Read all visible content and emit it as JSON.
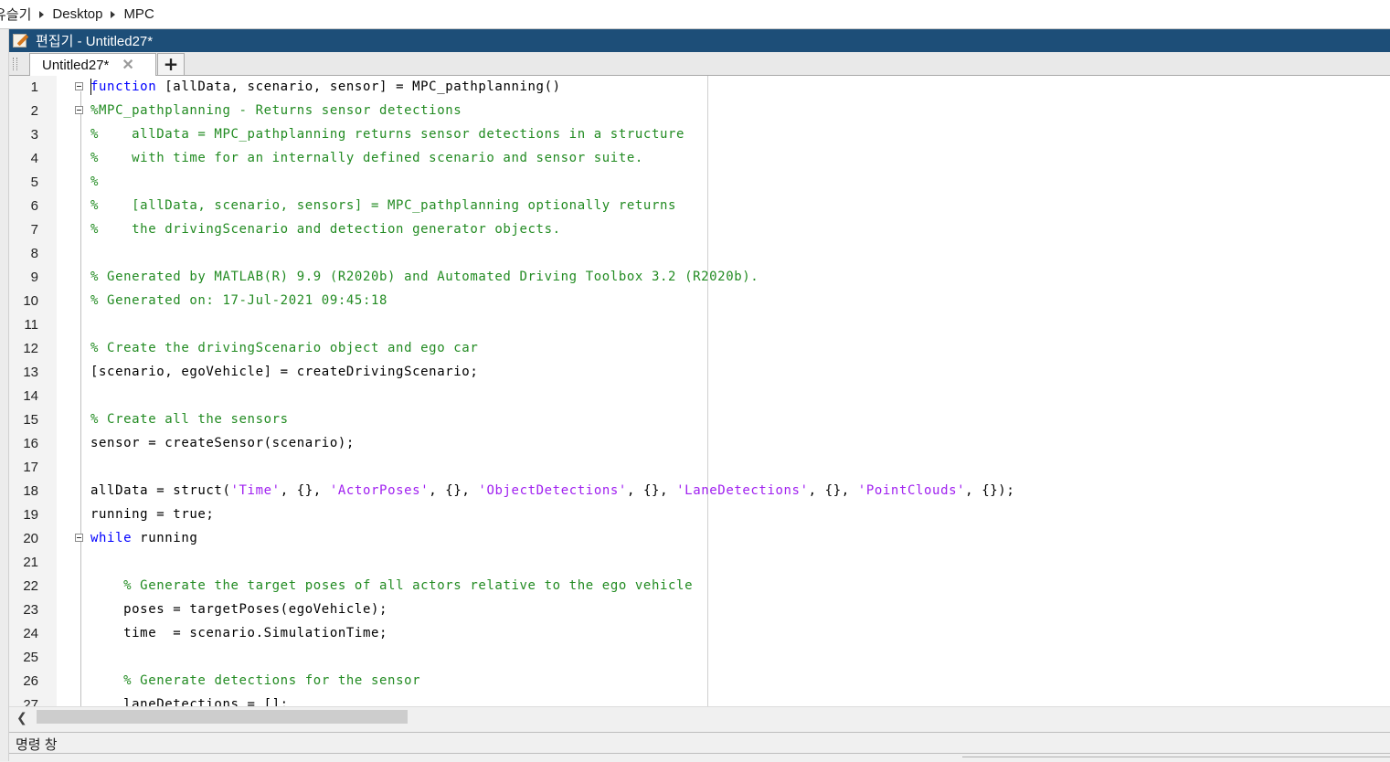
{
  "breadcrumb": {
    "items": [
      "유슬기",
      "Desktop",
      "MPC"
    ]
  },
  "editor_window": {
    "title": "편집기 - Untitled27*"
  },
  "tabs": [
    {
      "label": "Untitled27*",
      "close_icon": "close-icon"
    }
  ],
  "add_tab_label": "+",
  "code_lines": [
    {
      "n": "1",
      "fold": true,
      "parts": [
        [
          "kw",
          "function"
        ],
        [
          "p",
          " [allData, scenario, sensor] = MPC_pathplanning()"
        ]
      ]
    },
    {
      "n": "2",
      "fold": true,
      "parts": [
        [
          "cm",
          "%MPC_pathplanning - Returns sensor detections"
        ]
      ]
    },
    {
      "n": "3",
      "fold": false,
      "parts": [
        [
          "cm",
          "%    allData = MPC_pathplanning returns sensor detections in a structure"
        ]
      ]
    },
    {
      "n": "4",
      "fold": false,
      "parts": [
        [
          "cm",
          "%    with time for an internally defined scenario and sensor suite."
        ]
      ]
    },
    {
      "n": "5",
      "fold": false,
      "parts": [
        [
          "cm",
          "%"
        ]
      ]
    },
    {
      "n": "6",
      "fold": false,
      "parts": [
        [
          "cm",
          "%    [allData, scenario, sensors] = MPC_pathplanning optionally returns"
        ]
      ]
    },
    {
      "n": "7",
      "fold": false,
      "parts": [
        [
          "cm",
          "%    the drivingScenario and detection generator objects."
        ]
      ]
    },
    {
      "n": "8",
      "fold": false,
      "parts": []
    },
    {
      "n": "9",
      "fold": false,
      "parts": [
        [
          "cm",
          "% Generated by MATLAB(R) 9.9 (R2020b) and Automated Driving Toolbox 3.2 (R2020b)."
        ]
      ]
    },
    {
      "n": "10",
      "fold": false,
      "parts": [
        [
          "cm",
          "% Generated on: 17-Jul-2021 09:45:18"
        ]
      ]
    },
    {
      "n": "11",
      "fold": false,
      "parts": []
    },
    {
      "n": "12",
      "fold": false,
      "parts": [
        [
          "cm",
          "% Create the drivingScenario object and ego car"
        ]
      ]
    },
    {
      "n": "13",
      "fold": false,
      "parts": [
        [
          "p",
          "[scenario, egoVehicle] = createDrivingScenario;"
        ]
      ]
    },
    {
      "n": "14",
      "fold": false,
      "parts": []
    },
    {
      "n": "15",
      "fold": false,
      "parts": [
        [
          "cm",
          "% Create all the sensors"
        ]
      ]
    },
    {
      "n": "16",
      "fold": false,
      "parts": [
        [
          "p",
          "sensor = createSensor(scenario);"
        ]
      ]
    },
    {
      "n": "17",
      "fold": false,
      "parts": []
    },
    {
      "n": "18",
      "fold": false,
      "parts": [
        [
          "p",
          "allData = struct("
        ],
        [
          "st",
          "'Time'"
        ],
        [
          "p",
          ", {}, "
        ],
        [
          "st",
          "'ActorPoses'"
        ],
        [
          "p",
          ", {}, "
        ],
        [
          "st",
          "'ObjectDetections'"
        ],
        [
          "p",
          ", {}, "
        ],
        [
          "st",
          "'LaneDetections'"
        ],
        [
          "p",
          ", {}, "
        ],
        [
          "st",
          "'PointClouds'"
        ],
        [
          "p",
          ", {});"
        ]
      ]
    },
    {
      "n": "19",
      "fold": false,
      "parts": [
        [
          "p",
          "running = true;"
        ]
      ]
    },
    {
      "n": "20",
      "fold": true,
      "parts": [
        [
          "kw",
          "while"
        ],
        [
          "p",
          " running"
        ]
      ]
    },
    {
      "n": "21",
      "fold": false,
      "parts": []
    },
    {
      "n": "22",
      "fold": false,
      "parts": [
        [
          "p",
          "    "
        ],
        [
          "cm",
          "% Generate the target poses of all actors relative to the ego vehicle"
        ]
      ]
    },
    {
      "n": "23",
      "fold": false,
      "parts": [
        [
          "p",
          "    poses = targetPoses(egoVehicle);"
        ]
      ]
    },
    {
      "n": "24",
      "fold": false,
      "parts": [
        [
          "p",
          "    time  = scenario.SimulationTime;"
        ]
      ]
    },
    {
      "n": "25",
      "fold": false,
      "parts": []
    },
    {
      "n": "26",
      "fold": false,
      "parts": [
        [
          "p",
          "    "
        ],
        [
          "cm",
          "% Generate detections for the sensor"
        ]
      ]
    },
    {
      "n": "27",
      "fold": false,
      "parts": [
        [
          "p",
          "    laneDetections = [];"
        ]
      ]
    }
  ],
  "command_window": {
    "title": "명령 창"
  },
  "colors": {
    "titlebar": "#1d4e78",
    "keyword": "#0000ff",
    "comment": "#228b22",
    "string": "#a020f0"
  }
}
